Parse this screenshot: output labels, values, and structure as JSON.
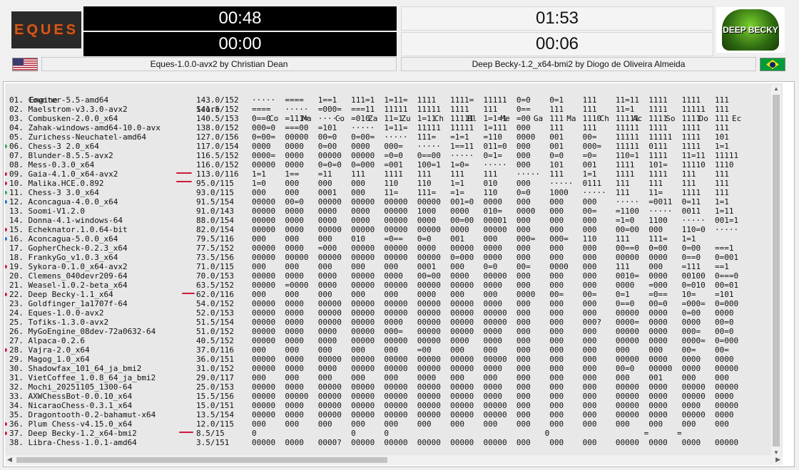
{
  "left_player": {
    "logo_text": "EQUES",
    "clock_main": "00:48",
    "clock_move": "00:00",
    "name": "Eques-1.0.0-avx2 by Christian Dean",
    "flag": "us-flag-icon"
  },
  "right_player": {
    "logo_text": "DEEP BECKY",
    "clock_main": "01:53",
    "clock_move": "00:06",
    "name": "Deep Becky-1.2_x64-bmi2 by Diogo de Oliveira Almeida",
    "flag": "brazil-flag-icon"
  },
  "table": {
    "header_engine": "Engine",
    "header_score": "Score",
    "header_cols": "Co     Ma     Co     Za     Zu     Ch     Bl     Me     Ga     Ma     Ch     Ac     So     Do     Ec",
    "rows": [
      {
        "eng": "01. Counter-5.5-amd64",
        "score": "143.0/152",
        "cells": "·····  ====   1==1   111=1  1=11=  1111   1111=  11111  0=0    0=1    111    11=11  1111   1111   111"
      },
      {
        "eng": "02. Maelstrom-v3.3.0-avx2",
        "score": "141.5/152",
        "cells": "====   ·····  =000=  ===11  11111  11111  1111   111    0==    111    111    11=1   1111   11111  111"
      },
      {
        "eng": "03. Combusken-2.0.0_x64",
        "score": "140.5/153",
        "cells": "0==0   =111=  ·····  =010   11=1   1=11   11111  1=1=1  =00    111    1110   11111  1111   1111   111"
      },
      {
        "eng": "04. Zahak-windows-amd64-10.0-avx",
        "score": "138.0/152",
        "cells": "000=0  ===00  =101   ·····  1=11=  11111  11111  1=111  000    111    111    11111  1111   1111   111"
      },
      {
        "eng": "05. Zurichess-Neuchatel-amd64",
        "score": "127.0/156",
        "cells": "0=00=  00000  00=0   0=00=  ·····  111=   =1=1   =110   0000   001    00=    11111  11111  1111   101"
      },
      {
        "eng": "06. Chess-3 2.0_x64",
        "score": "117.0/154",
        "cells": "0000   0000   0=00   0000   000=   ·····  1==11  011=0  000    001    000=   11111  0111   1111   1=1"
      },
      {
        "eng": "07. Blunder-8.5.5-avx2",
        "score": "116.5/152",
        "cells": "0000=  0000   00000  00000  =0=0   0==00  ·····  0=1=   000    0=0    =0=    110=1  1111   11=11  11111"
      },
      {
        "eng": "08. Mess-0.3.0_x64",
        "score": "116.0/152",
        "cells": "00000  0000   0=0=0  0=000  =001   100=1  1=0=   ·····  000    101    001    1111   101=   11110  1110"
      },
      {
        "eng": "09. Gaia-4.1.0_x64-avx2",
        "score": "113.0/116",
        "cells": "1=1    1==    =11    111    1111   111    111    111    ·····  111    1=1    1111   1111   111    111"
      },
      {
        "eng": "10. Malika.HCE.0.892",
        "score": "95.0/115",
        "cells": "1=0    000    000    000    110    110    1=1    010    000    ·····  0111   111    111    111    111"
      },
      {
        "eng": "11. Chess-3 3.0_x64",
        "score": "93.0/115",
        "cells": "000    000    0001   000    11=    111=   =1=    110    0=0    1000   ·····  111    11=    1111   111"
      },
      {
        "eng": "12. Aconcagua-4.0.0_x64",
        "score": "91.5/154",
        "cells": "00000  00=0   00000  00000  00000  00000  001=0  0000   000    000    000    ·····  =0011  0=11   1=1"
      },
      {
        "eng": "13. Soomi-V1.2.0",
        "score": "91.0/143",
        "cells": "00000  0000   0000   0000   00000  1000   0000   010=   0000   000    00=    =1100  ·····  0011   1=11"
      },
      {
        "eng": "14. Donna-4.1-windows-64",
        "score": "88.0/154",
        "cells": "00000  0000   0000   0000   00000  0000   00=00  00001  000    000    000    =1=0   1100   ·····  001=1"
      },
      {
        "eng": "15. Echeknator.1.0.64-bit",
        "score": "82.0/154",
        "cells": "00000  0000   00000  00000  00000  00000  0000   00000  000    000    000    00=00  000    110=0  ·····"
      },
      {
        "eng": "16. Aconcagua-5.0.0_x64",
        "score": "79.5/116",
        "cells": "000    000    000    010    =0==   0=0    001    000    000=   000=   110    111    111=   1=1"
      },
      {
        "eng": "17. GopherCheck-0.2.3_x64",
        "score": "77.5/152",
        "cells": "00000  0000   =000   00000  00000  0000   00000  0000   000    000    000    00==0  0=00   0=00   ===1"
      },
      {
        "eng": "18. FrankyGo_v1.0.3_x64",
        "score": "73.5/156",
        "cells": "00000  00000  00000  00000  00000  00000  0=000  0000   000    000    000    00000  0000   0==0   0=001"
      },
      {
        "eng": "19. Sykora-0.1.0_x64-avx2",
        "score": "71.0/115",
        "cells": "000    000    000    000    000    0001   000    0=0    00=    0000   000    111    000    =111   ==1"
      },
      {
        "eng": "20. Clemens_040devr209-64",
        "score": "70.0/153",
        "cells": "00000  0000   0000   00000  0000   00=00  0000   00000  000    000    000    0010=  0000   00100  0===0"
      },
      {
        "eng": "21. Weasel-1.0.2-beta_x64",
        "score": "63.5/152",
        "cells": "00000  =0000  0000   00000  00000  00000  00000  0000   000    000    000    0000   =000   0=010  00=01"
      },
      {
        "eng": "22. Deep Becky-1.1_x64",
        "score": "62.0/116",
        "cells": "000    000    000    000    000    0000   000    000    0000   00=    00=    0=1    =0==   10=    =101"
      },
      {
        "eng": "23. Goldfinger_1a1707f-64",
        "score": "54.0/152",
        "cells": "00000  0000   00000  00000  00000  00000  00000  0000   000    000    000    0==0   00=0   =000=  0=000"
      },
      {
        "eng": "24. Eques-1.0.0-avx2",
        "score": "52.0/153",
        "cells": "00000  0000   00000  00000  00000  00000  00000  00000  000    000    000    00000  0000   0=00   0000"
      },
      {
        "eng": "25. Tofiks-1.3.0-avx2",
        "score": "51.5/154",
        "cells": "00000  0000   00000  00000  0000   00000  00000  00000  000    000    000?   0000=  0000   0000   00=0"
      },
      {
        "eng": "26. MyGoEngine_08dev-72a0632-64",
        "score": "51.0/152",
        "cells": "00000  0000   0000   00000  000=   00000  00000  0000   000    000    000    00000  0000   000=   00=0"
      },
      {
        "eng": "27. Alpaca-0.2.6",
        "score": "40.5/152",
        "cells": "00000  0000   0000   00000  00000  00000  0000   0000   000    000    000    00000  0000   0000=  0=000"
      },
      {
        "eng": "28. Vajra-2.0_x64",
        "score": "37.0/116",
        "cells": "000    000    000    000    000    =00    000    000    000    000    000    000    000    00=    00="
      },
      {
        "eng": "29. Magog_1.0_x64",
        "score": "36.0/151",
        "cells": "00000  0000   00000  00000  00000  00000  00000  00000  000    000    000    00000  0000   0000   0000"
      },
      {
        "eng": "30. Shadowfax_101_64_ja_bmi2",
        "score": "31.0/152",
        "cells": "00000  0000   0000   00000  00000  00000  00000  0000   000    000    000    00=0   00000  0000   00000"
      },
      {
        "eng": "31. VietCoffee_1.0.8_64_ja_bmi2",
        "score": "29.0/117",
        "cells": "000    000    000    000    000    0000   000    000    000    000    000    000    001    000    000"
      },
      {
        "eng": "32. Mochi_20251105_1300-64",
        "score": "25.0/153",
        "cells": "00000  0000   00000  00000  00000  00000  00000  0000   000    000    000    00000  0000   00000  00000"
      },
      {
        "eng": "33. AXWChessBot-0.0.10_x64",
        "score": "15.5/156",
        "cells": "00000  00000  00000  00000  00000  00000  00000  0000   000    000    000    00000  0000   00000  0000"
      },
      {
        "eng": "34. NicaraoChess-0.3.1_x64",
        "score": "15.0/151",
        "cells": "00000  0000   00000  00000  00000  00000  00000  00000  000    000    000    00000  0000   0000   00000"
      },
      {
        "eng": "35. Dragontooth-0.2-bahamut-x64",
        "score": "13.5/154",
        "cells": "00000  0000   00000  00000  00000  00000  00000  00000  000    000    000    00000  0000   00000  0000"
      },
      {
        "eng": "36. Plum Chess-v4.15.0_x64",
        "score": "12.0/115",
        "cells": "000    000    000    000    000    000    000    000    000    000    000    000    000    000    000"
      },
      {
        "eng": "37. Deep Becky-1.2_x64-bmi2",
        "score": "8.5/15",
        "cells": "0                    0      0                                 0                    =      ="
      },
      {
        "eng": "38. Libra-Chess-1.0.1-amd64",
        "score": "3.5/151",
        "cells": "00000  0000   0000?  00000  00000  00000  00000  00000  000    000    000    00000  0000   0000   00000"
      }
    ]
  },
  "colors": {
    "clock_dark": "#000000",
    "marker_red": "#cc1a3a",
    "marker_green": "#2fa84f",
    "marker_blue": "#2a6fd6",
    "table_bg": "#e8e8e8"
  }
}
